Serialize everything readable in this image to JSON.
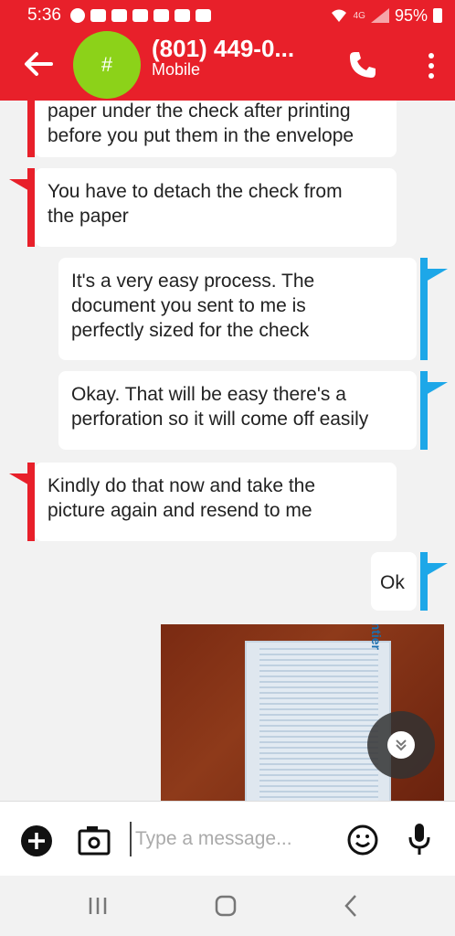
{
  "status_bar": {
    "time": "5:36",
    "network": "4G",
    "battery": "95%"
  },
  "header": {
    "avatar_initial": "#",
    "title": "(801) 449-0...",
    "subtitle": "Mobile"
  },
  "messages": [
    {
      "side": "in",
      "lines": [
        "paper under the check after printing",
        "before you put them in the envelope"
      ]
    },
    {
      "side": "in",
      "lines": [
        "You have to detach the check from",
        "the paper"
      ]
    },
    {
      "side": "out",
      "lines": [
        "It's a very easy process. The",
        "document you sent to me is",
        "perfectly sized for the check"
      ]
    },
    {
      "side": "out",
      "lines": [
        "Okay. That will be easy there's a",
        "perforation so it will come off easily"
      ]
    },
    {
      "side": "in",
      "lines": [
        "Kindly do that now and take the",
        "picture again and resend to me"
      ]
    },
    {
      "side": "out",
      "lines": [
        "Ok"
      ]
    }
  ],
  "photo": {
    "logo": "Frontier"
  },
  "composer": {
    "placeholder": "Type a message..."
  },
  "colors": {
    "brand": "#e8202a",
    "outgoing_accent": "#1da7e8",
    "avatar": "#8cd219"
  }
}
